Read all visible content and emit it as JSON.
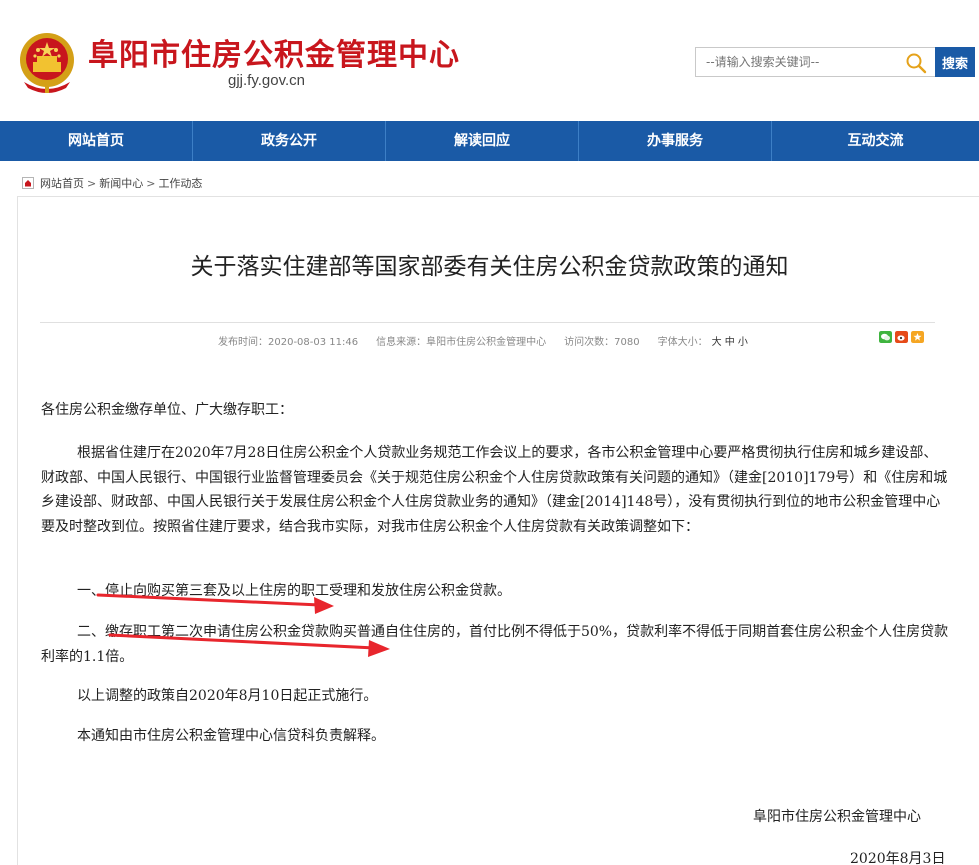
{
  "header": {
    "site_title": "阜阳市住房公积金管理中心",
    "domain": "gjj.fy.gov.cn",
    "search_placeholder": "--请输入搜索关键词--",
    "search_button": "搜索",
    "accent_color": "#c8161d",
    "brand_color": "#1a5aa6"
  },
  "nav": {
    "items": [
      "网站首页",
      "政务公开",
      "解读回应",
      "办事服务",
      "互动交流"
    ]
  },
  "breadcrumb": {
    "items": [
      "网站首页",
      "新闻中心",
      "工作动态"
    ],
    "separator": ">"
  },
  "article": {
    "title": "关于落实住建部等国家部委有关住房公积金贷款政策的通知",
    "meta": {
      "publish_time": "发布时间：2020-08-03 11:46",
      "source": "信息来源：阜阳市住房公积金管理中心",
      "visits": "访问次数：7080",
      "font_size_label": "字体大小：",
      "font_size_options": "大 中 小"
    },
    "share_icons": [
      "wechat-icon",
      "weibo-icon",
      "favorite-icon"
    ],
    "salutation": "各住房公积金缴存单位、广大缴存职工：",
    "paragraph1": "根据省住建厅在2020年7月28日住房公积金个人贷款业务规范工作会议上的要求，各市公积金管理中心要严格贯彻执行住房和城乡建设部、财政部、中国人民银行、中国银行业监督管理委员会《关于规范住房公积金个人住房贷款政策有关问题的通知》（建金[2010]179号）和《住房和城乡建设部、财政部、中国人民银行关于发展住房公积金个人住房贷款业务的通知》（建金[2014]148号），没有贯彻执行到位的地市公积金管理中心要及时整改到位。按照省住建厅要求，结合我市实际，对我市住房公积金个人住房贷款有关政策调整如下：",
    "item1": "一、停止向购买第三套及以上住房的职工受理和发放住房公积金贷款。",
    "item2": "二、缴存职工第二次申请住房公积金贷款购买普通自住住房的，首付比例不得低于50%，贷款利率不得低于同期首套住房公积金个人住房贷款利率的1.1倍。",
    "effective": "以上调整的政策自2020年8月10日起正式施行。",
    "interpretation": "本通知由市住房公积金管理中心信贷科负责解释。",
    "signature": "阜阳市住房公积金管理中心",
    "date": "2020年8月3日"
  }
}
